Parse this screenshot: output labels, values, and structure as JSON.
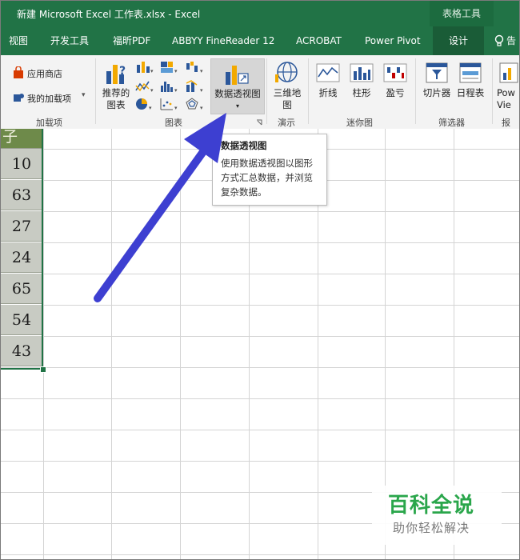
{
  "window": {
    "title": "新建 Microsoft Excel 工作表.xlsx  -  Excel",
    "contextual_tab_group": "表格工具"
  },
  "tabs": [
    {
      "label": "视图"
    },
    {
      "label": "开发工具"
    },
    {
      "label": "福昕PDF"
    },
    {
      "label": "ABBYY FineReader 12"
    },
    {
      "label": "ACROBAT"
    },
    {
      "label": "Power Pivot"
    },
    {
      "label": "设计",
      "active": true
    }
  ],
  "tell_me": {
    "label": "告"
  },
  "ribbon": {
    "addins": {
      "store_label": "应用商店",
      "my_addins_label": "我的加载项",
      "group_label": "加载项"
    },
    "charts": {
      "recommended_line1": "推荐的",
      "recommended_line2": "图表",
      "pivot_chart_label": "数据透视图",
      "group_label": "图表"
    },
    "tours": {
      "map3d_line1": "三维地",
      "map3d_line2": "图",
      "group_label": "演示"
    },
    "sparklines": {
      "line_label": "折线",
      "column_label": "柱形",
      "winloss_label": "盈亏",
      "group_label": "迷你图"
    },
    "filters": {
      "slicer_label": "切片器",
      "timeline_label": "日程表",
      "group_label": "筛选器"
    },
    "reports": {
      "powerview_line1": "Pow",
      "powerview_line2": "Vie",
      "group_label": "报"
    }
  },
  "sheet": {
    "column_header_text": "子",
    "values": [
      "10",
      "63",
      "27",
      "24",
      "65",
      "54",
      "43"
    ]
  },
  "tooltip": {
    "title": "数据透视图",
    "lines": [
      "使用数据透视图以图形",
      "方式汇总数据，并浏览",
      "复杂数据。"
    ]
  },
  "watermark": {
    "main": "百科全说",
    "sub": "助你轻松解决"
  },
  "colors": {
    "excel_green": "#217346",
    "arrow": "#3d3fd1",
    "watermark_green": "#2aa64b"
  }
}
